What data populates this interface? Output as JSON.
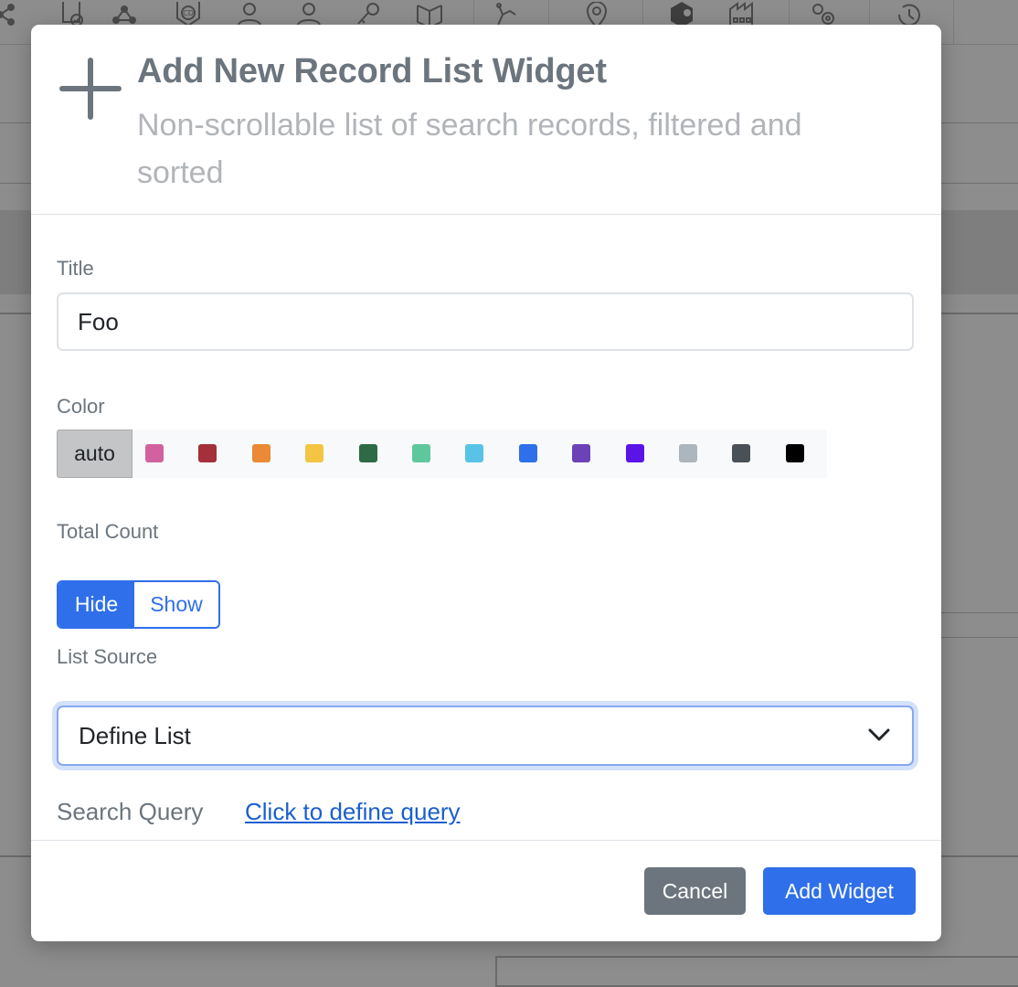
{
  "background": {
    "toolbar_icons": [
      "share-icon",
      "document-check-icon",
      "network-icon",
      "cd-badge-icon",
      "user-outline-icon",
      "user-icon",
      "key-icon",
      "cube-icon",
      "lamp-icon",
      "map-pin-icon",
      "hexagon-icon",
      "factory-icon",
      "gears-icon",
      "history-icon"
    ]
  },
  "modal": {
    "title": "Add New Record List Widget",
    "subtitle": "Non-scrollable list of search records, filtered and sorted",
    "fields": {
      "title_label": "Title",
      "title_value": "Foo",
      "color_label": "Color",
      "color_auto": "auto",
      "colors": [
        "#d2629f",
        "#a3303a",
        "#ea8936",
        "#f4c443",
        "#2d6a45",
        "#5fc79c",
        "#58c3e6",
        "#2f6fea",
        "#6c42b8",
        "#5a14e8",
        "#adb5bd",
        "#495057",
        "#000000"
      ],
      "total_count_label": "Total Count",
      "total_count_options": {
        "hide": "Hide",
        "show": "Show"
      },
      "total_count_selected": "Hide",
      "list_source_label": "List Source",
      "list_source_value": "Define List",
      "search_query_label": "Search Query",
      "search_query_link": "Click to define query"
    },
    "footer": {
      "cancel_label": "Cancel",
      "add_label": "Add Widget"
    },
    "accent_color": "#2f6fea"
  }
}
